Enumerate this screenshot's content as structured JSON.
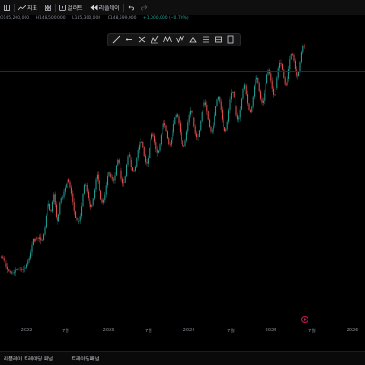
{
  "toolbar": {
    "indicators_label": "지표",
    "alerts_label": "얼러트",
    "replay_label": "리플레이"
  },
  "ohlc": {
    "open": "145,200,000",
    "high": "148,500,000",
    "low": "145,300,000",
    "close": "148,599,000",
    "change": "+1,000,000 (+0.70%)"
  },
  "drawing_tools": [
    "line-tool-icon",
    "ray-tool-icon",
    "hline-tool-icon",
    "pitchfork-icon",
    "pattern-icon",
    "wave-icon",
    "triangle-icon",
    "fib-icon",
    "rect-icon",
    "brush-icon"
  ],
  "x_axis": {
    "labels": [
      "2022",
      "7월",
      "2023",
      "7월",
      "2024",
      "7월",
      "2025",
      "7월",
      "2026"
    ]
  },
  "bottom": {
    "tab1": "리플레이 트레이딩 패널",
    "tab2": "트레이딩패널"
  },
  "colors": {
    "up": "#26a69a",
    "down": "#ef5350",
    "background": "#000000"
  },
  "chart_data": {
    "type": "line",
    "x_start": "2021-10",
    "x_end": "2025-07",
    "series": [
      {
        "values": [
          76,
          79,
          82,
          80,
          77,
          72,
          75,
          74,
          70,
          66,
          64,
          62,
          58,
          56,
          54,
          50,
          47,
          44,
          40,
          35,
          33,
          31,
          28,
          27,
          26,
          24,
          22,
          21,
          19,
          20,
          21,
          20,
          19,
          19,
          18,
          19,
          20,
          19,
          18,
          20,
          23,
          24,
          28,
          30,
          28,
          27,
          30,
          31,
          29,
          31,
          34,
          33,
          36,
          34,
          33,
          35,
          32,
          31,
          33,
          30,
          29,
          31,
          30,
          32,
          33,
          31,
          32,
          34,
          33,
          34,
          36,
          40,
          44,
          47,
          50,
          48,
          53,
          59,
          63,
          67,
          71,
          73,
          74,
          77,
          80,
          94,
          105,
          112,
          118,
          122,
          129,
          135,
          140,
          137,
          136,
          133,
          131,
          134,
          141,
          144,
          148,
          145,
          144,
          141,
          138,
          139,
          140,
          143,
          147,
          147,
          149,
          145,
          141,
          136,
          133,
          131,
          134,
          138,
          145,
          150,
          157,
          163,
          172,
          178,
          187,
          200,
          207,
          221,
          234,
          245,
          255,
          262,
          268,
          275,
          271,
          266,
          257,
          250,
          244,
          240,
          236,
          239,
          243,
          250,
          263,
          275,
          287,
          298,
          305,
          303,
          296,
          284,
          268,
          253,
          240,
          229,
          219,
          211,
          206,
          204,
          209,
          216,
          224,
          233,
          246,
          258,
          270,
          280,
          285,
          287,
          290,
          293,
          294,
          292,
          296,
          302,
          308,
          313,
          318,
          322,
          324,
          327,
          332,
          337,
          342,
          347,
          350,
          354,
          357,
          355,
          353,
          348,
          344,
          339,
          333,
          327,
          322,
          315,
          307,
          299,
          290,
          281,
          272,
          263,
          253,
          243,
          233,
          227,
          222,
          218,
          216,
          213,
          210,
          208,
          206,
          205,
          204,
          203,
          203,
          205,
          208,
          212,
          218,
          226,
          234,
          244,
          256,
          268,
          280,
          294,
          306,
          318,
          328,
          336,
          341,
          344,
          343,
          338,
          332,
          325,
          317,
          310,
          302,
          296,
          289,
          282,
          276,
          270,
          266,
          263,
          261,
          259,
          258,
          260,
          262,
          266,
          271,
          278,
          285,
          293,
          301,
          311,
          321,
          332,
          344,
          354,
          362,
          370,
          374,
          375,
          372,
          366,
          357,
          347,
          337,
          326,
          315,
          305,
          295,
          287,
          281,
          277,
          274,
          273,
          274,
          276,
          279,
          283,
          288,
          295,
          302,
          310,
          320,
          330,
          341,
          351,
          361,
          369,
          376,
          381,
          383,
          384,
          383,
          381,
          379,
          376,
          373,
          370,
          366,
          363,
          360,
          357,
          355,
          353,
          352,
          353,
          356,
          361,
          369,
          378,
          389,
          399,
          409,
          417,
          423,
          427,
          428,
          427,
          423,
          417,
          410,
          402,
          393,
          384,
          375,
          367,
          359,
          353,
          348,
          345,
          343,
          342,
          343,
          345,
          349,
          355,
          363,
          373,
          384,
          396,
          408,
          419,
          429,
          437,
          443,
          447,
          449,
          449,
          446,
          441,
          434,
          426,
          418,
          410,
          403,
          397,
          392,
          389,
          387,
          386,
          386,
          387,
          389,
          393,
          398,
          404,
          411,
          419,
          428,
          437,
          446,
          455,
          463,
          470,
          476,
          481,
          485,
          488,
          490,
          492,
          494,
          495,
          494,
          492,
          488,
          482,
          475,
          467,
          458,
          449,
          441,
          433,
          426,
          421,
          417,
          415,
          414,
          415,
          418,
          423,
          430,
          438,
          448,
          459,
          470,
          481,
          491,
          500,
          508,
          514,
          519,
          522,
          523,
          522,
          519,
          514,
          508,
          501,
          493,
          485,
          477,
          470,
          464,
          459,
          456,
          454,
          454,
          455,
          458,
          462,
          468,
          475,
          483,
          492,
          502,
          512,
          521,
          530,
          538,
          545,
          551,
          556,
          559,
          561,
          561,
          559,
          556,
          551,
          545,
          538,
          531,
          523,
          515,
          508,
          501,
          495,
          490,
          486,
          484,
          483,
          483,
          485,
          488,
          493,
          499,
          506,
          514,
          522,
          531,
          540,
          549,
          557,
          565,
          572,
          578,
          583,
          587,
          590,
          592,
          593,
          592,
          589,
          585,
          579,
          572,
          564,
          555,
          546,
          536,
          526,
          517,
          508,
          500,
          493,
          487,
          482,
          479,
          477,
          477,
          478,
          481,
          485,
          491,
          498,
          506,
          515,
          525,
          535,
          545,
          555,
          564,
          573,
          581,
          588,
          594,
          599,
          603,
          605,
          606,
          605,
          603,
          599,
          594,
          588,
          581,
          573,
          565,
          556,
          548,
          540,
          532,
          525,
          519,
          514,
          510,
          508,
          507,
          508,
          510,
          514,
          520,
          527,
          535,
          544,
          554,
          564,
          574,
          584,
          593,
          602,
          610,
          617,
          623,
          628,
          632,
          635,
          636,
          636,
          634,
          631,
          626,
          620,
          613,
          605,
          597,
          588,
          579,
          570,
          562,
          554,
          547,
          541,
          536,
          532,
          530,
          529,
          530,
          532,
          536,
          541,
          548,
          556,
          565,
          575,
          585,
          595,
          605,
          614,
          623,
          631,
          638,
          644,
          649,
          652,
          654,
          654,
          652,
          648,
          643,
          636,
          628,
          619,
          609,
          599,
          589,
          579,
          570,
          561,
          553,
          546,
          540,
          536,
          533,
          531,
          531,
          533,
          537,
          543,
          550,
          559,
          569,
          580,
          592,
          604,
          616,
          627,
          638,
          648,
          657,
          664,
          670,
          674,
          676,
          676,
          674,
          670,
          664,
          657,
          649,
          640,
          630,
          620,
          611,
          602,
          594,
          587,
          581,
          577,
          574,
          573,
          574,
          577,
          582,
          589,
          598,
          608,
          619,
          630,
          642,
          653,
          664,
          674,
          683,
          690,
          696,
          700,
          702,
          702,
          700,
          696,
          690,
          683,
          674,
          665,
          655,
          645,
          636,
          627,
          619,
          612,
          607,
          603,
          601,
          601,
          603,
          607,
          613,
          620,
          629,
          639,
          650,
          661,
          672,
          683,
          693,
          702,
          710,
          716,
          721,
          724,
          725,
          724,
          721,
          717,
          711,
          704,
          696,
          687,
          678,
          669,
          661,
          653,
          646,
          641,
          637,
          635,
          634,
          635,
          638,
          643,
          649,
          657,
          666,
          676,
          686,
          697,
          708,
          718,
          727,
          735,
          742,
          747,
          750,
          752,
          751,
          749,
          745,
          739,
          732,
          724,
          715,
          706,
          697,
          689,
          681,
          674,
          669,
          665,
          662,
          661,
          662,
          665,
          670,
          677,
          685,
          695,
          705,
          716,
          727,
          738,
          748,
          757,
          765,
          772,
          777,
          780,
          782,
          781,
          778,
          774,
          768,
          761,
          753,
          744,
          735,
          727,
          719,
          712,
          706,
          702,
          699,
          698,
          699,
          702,
          706,
          712,
          720,
          729,
          739,
          750,
          761,
          772,
          782,
          791,
          799,
          805,
          810,
          813,
          814,
          813,
          810,
          805,
          799,
          792,
          784,
          775,
          766,
          758,
          750,
          743,
          737,
          733,
          730,
          729,
          729,
          731,
          735,
          741,
          749,
          758,
          768,
          778,
          789,
          800,
          810,
          819,
          827,
          833,
          838,
          841,
          842,
          841,
          838
        ]
      }
    ]
  }
}
